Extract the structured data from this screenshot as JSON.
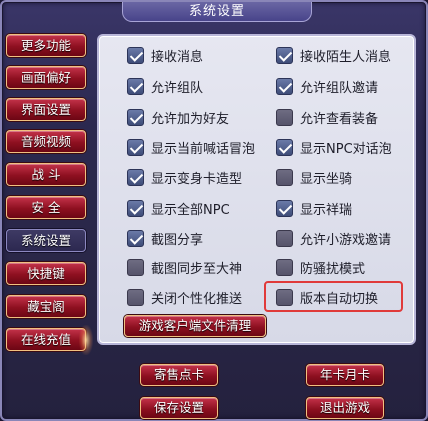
{
  "window": {
    "title": "系统设置"
  },
  "sidebar": {
    "items": [
      {
        "label": "更多功能",
        "active": false
      },
      {
        "label": "画面偏好",
        "active": false
      },
      {
        "label": "界面设置",
        "active": false
      },
      {
        "label": "音频视频",
        "active": false
      },
      {
        "label": "战 斗",
        "active": false
      },
      {
        "label": "安 全",
        "active": false
      },
      {
        "label": "系统设置",
        "active": true
      },
      {
        "label": "快捷键",
        "active": false
      },
      {
        "label": "藏宝阁",
        "active": false
      },
      {
        "label": "在线充值",
        "active": false
      }
    ]
  },
  "options": {
    "left": [
      {
        "label": "接收消息",
        "checked": true
      },
      {
        "label": "允许组队",
        "checked": true
      },
      {
        "label": "允许加为好友",
        "checked": true
      },
      {
        "label": "显示当前喊话冒泡",
        "checked": true
      },
      {
        "label": "显示变身卡造型",
        "checked": true
      },
      {
        "label": "显示全部NPC",
        "checked": true
      },
      {
        "label": "截图分享",
        "checked": true
      },
      {
        "label": "截图同步至大神",
        "checked": false
      },
      {
        "label": "关闭个性化推送",
        "checked": false
      }
    ],
    "right": [
      {
        "label": "接收陌生人消息",
        "checked": true
      },
      {
        "label": "允许组队邀请",
        "checked": true
      },
      {
        "label": "允许查看装备",
        "checked": false
      },
      {
        "label": "显示NPC对话泡",
        "checked": true
      },
      {
        "label": "显示坐骑",
        "checked": false
      },
      {
        "label": "显示祥瑞",
        "checked": true
      },
      {
        "label": "允许小游戏邀请",
        "checked": false
      },
      {
        "label": "防骚扰模式",
        "checked": false
      },
      {
        "label": "版本自动切换",
        "checked": false
      }
    ]
  },
  "panel": {
    "clean_label": "游戏客户端文件清理"
  },
  "footer": {
    "consign_label": "寄售点卡",
    "monthly_label": "年卡月卡",
    "save_label": "保存设置",
    "exit_label": "退出游戏"
  },
  "colors": {
    "accent_red": "#8e1020",
    "highlight": "#e03a3a",
    "checkbox_on": "#3e4c78"
  }
}
